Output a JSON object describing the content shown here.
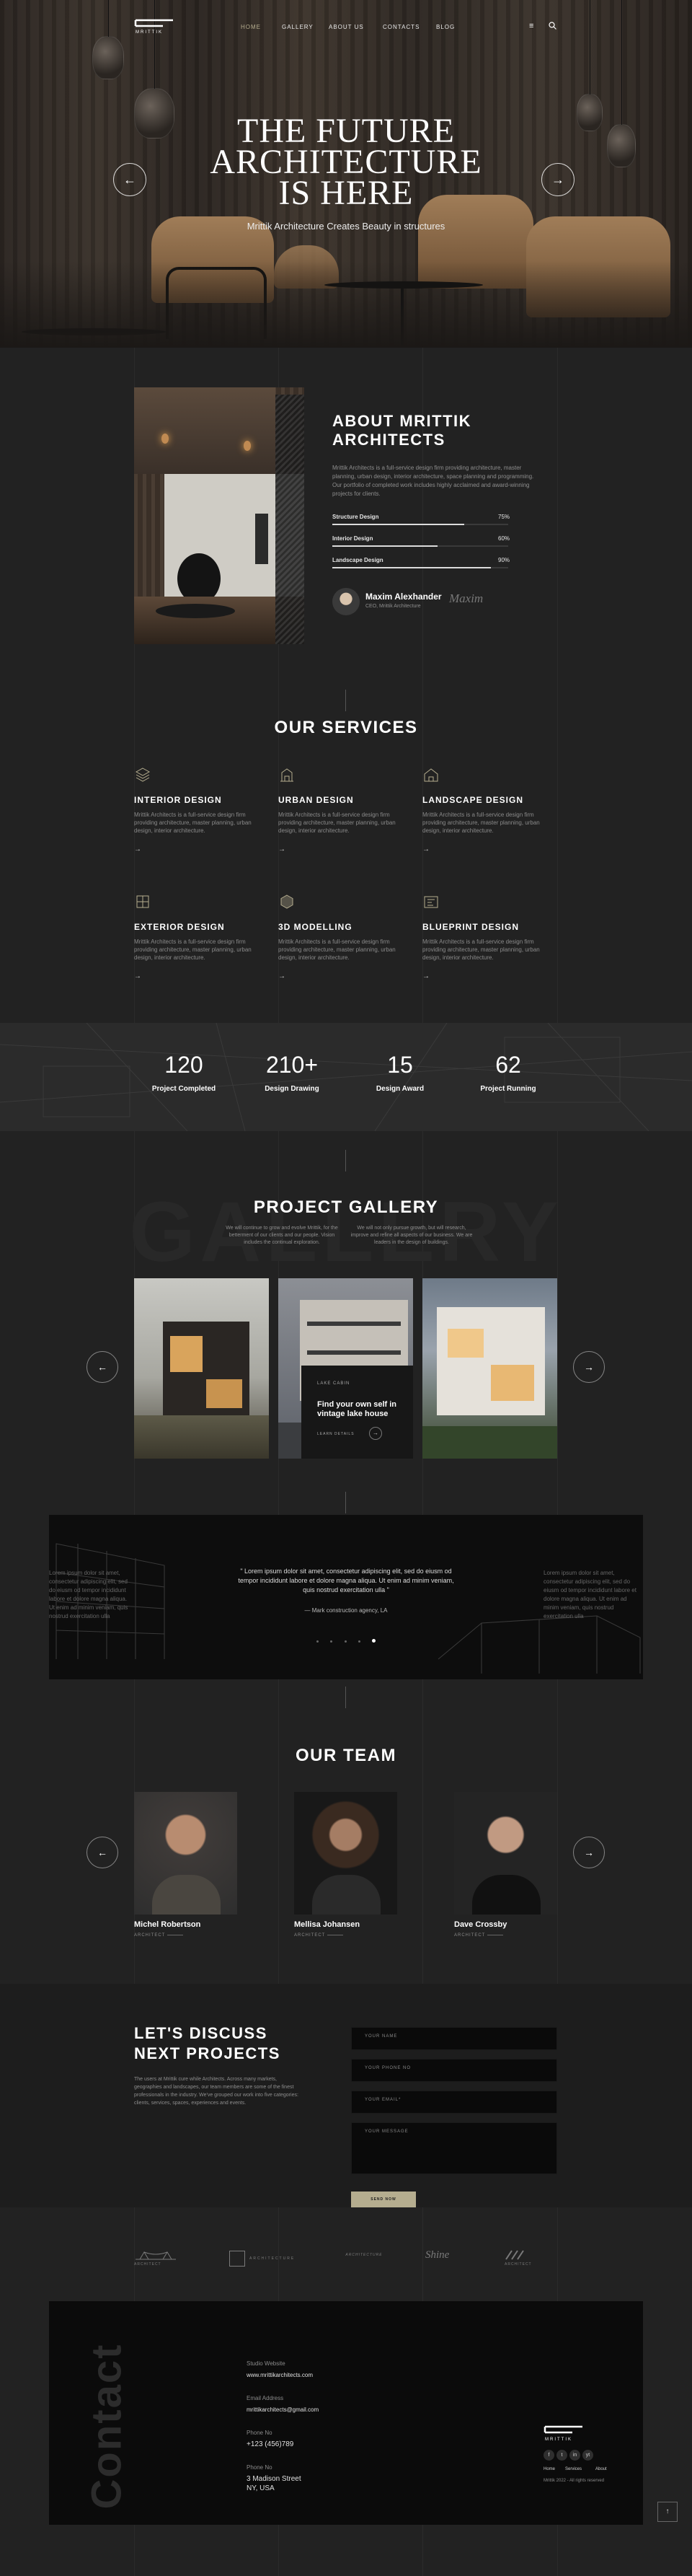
{
  "nav": {
    "items": [
      "HOME",
      "GALLERY",
      "ABOUT US",
      "CONTACTS",
      "BLOG"
    ]
  },
  "hero": {
    "title_lines": [
      "THE FUTURE",
      "ARCHITECTURE",
      "IS HERE"
    ],
    "subtitle": "Mrittik Architecture Creates Beauty in structures"
  },
  "about": {
    "heading_lines": [
      "ABOUT MRITTIK",
      "ARCHITECTS"
    ],
    "text": "Mrittik Architects is a full-service design firm providing architecture, master planning, urban design, interior architecture, space planning and programming. Our portfolio of completed work includes highly acclaimed and award-winning projects for clients.",
    "skills": [
      {
        "label": "Structure Design",
        "value": "75%",
        "fraction": 0.75
      },
      {
        "label": "Interior Design",
        "value": "60%",
        "fraction": 0.6
      },
      {
        "label": "Landscape Design",
        "value": "90%",
        "fraction": 0.9
      }
    ],
    "person_name": "Maxim Alexhander",
    "person_role": "CEO, Mrittik Architecture",
    "signature": "Maxim"
  },
  "services": {
    "heading": "OUR SERVICES",
    "desc": "Mrittik Architects is a full-service design firm providing architecture, master planning, urban design, interior architecture.",
    "items": [
      {
        "title": "INTERIOR DESIGN",
        "icon": "layers-icon"
      },
      {
        "title": "URBAN DESIGN",
        "icon": "city-icon"
      },
      {
        "title": "LANDSCAPE DESIGN",
        "icon": "house-icon"
      },
      {
        "title": "EXTERIOR DESIGN",
        "icon": "exterior-icon"
      },
      {
        "title": "3D MODELLING",
        "icon": "cube-icon"
      },
      {
        "title": "BLUEPRINT DESIGN",
        "icon": "blueprint-icon"
      }
    ]
  },
  "stats": [
    {
      "value": "120",
      "label": "Project Completed"
    },
    {
      "value": "210+",
      "label": "Design Drawing"
    },
    {
      "value": "15",
      "label": "Design Award"
    },
    {
      "value": "62",
      "label": "Project Running"
    }
  ],
  "gallery": {
    "heading": "PROJECT GALLERY",
    "watermark": "GALLERY",
    "intro_left": "We will continue to grow and evolve Mrittik, for the betterment of our clients and our people. Vision includes the continual exploration.",
    "intro_right": "We will not only pursue growth, but will research, improve and refine all aspects of our business. We are leaders in the design of buildings.",
    "card_tag": "LAKE CABIN",
    "card_title_lines": [
      "Find your own self in",
      "vintage lake house"
    ],
    "card_link": "LEARN DETAILS"
  },
  "testimonial": {
    "quote": "\" Lorem ipsum dolor sit amet, consectetur adipiscing elit, sed do eiusm od tempor incididunt labore et dolore magna aliqua. Ut enim ad minim veniam, quis nostrud exercitation ulla \"",
    "author": "Mark construction agency, LA",
    "side_left": "Lorem ipsum dolor sit amet, consectetur adipiscing elit, sed do eiusm od tempor incididunt labore et dolore magna aliqua. Ut enim ad minim veniam, quis nostrud exercitation ulla",
    "side_right": "Lorem ipsum dolor sit amet, consectetur adipiscing elit, sed do eiusm od tempor incididunt labore et dolore magna aliqua. Ut enim ad minim veniam, quis nostrud exercitation ulla"
  },
  "team": {
    "heading": "OUR TEAM",
    "members": [
      {
        "name": "Michel Robertson",
        "role": "ARCHITECT"
      },
      {
        "name": "Mellisa Johansen",
        "role": "ARCHITECT"
      },
      {
        "name": "Dave Crossby",
        "role": "ARCHITECT"
      }
    ]
  },
  "discuss": {
    "heading_lines": [
      "LET'S DISCUSS",
      "NEXT PROJECTS"
    ],
    "text": "The users at Mrittik cure while Architects. Across many markets, geographies and landscapes, our team members are some of the finest professionals in the industry. We've grouped our work into five categories: clients, services, spaces, experiences and events.",
    "fields": {
      "name": "YOUR NAME",
      "phone": "YOUR PHONE NO",
      "email": "YOUR EMAIL*",
      "message": "YOUR MESSAGE"
    },
    "submit": "SEND NOW"
  },
  "brands": [
    "ARCHITECT",
    "ARCHITECTURE",
    "ARCHITECTURE",
    "Shine",
    "ARCHITECT"
  ],
  "footer": {
    "side_title": "Contact",
    "studio_label": "Studio Website",
    "studio_value": "www.mrittikarchitects.com",
    "email_label": "Email Address",
    "email_value": "mrittikarchitects@gmail.com",
    "phone_label": "Phone No",
    "phone_value": "+123 (456)789",
    "office_label": "Phone No",
    "office_lines": [
      "3 Madison Street",
      "NY, USA"
    ],
    "logo_text": "MRITTIK",
    "social": [
      "f",
      "t",
      "in",
      "yt"
    ],
    "links": [
      "Home",
      "Services",
      "About"
    ],
    "copyright": "Mrittik 2022 - All rights reserved"
  },
  "colors": {
    "background": "#222222",
    "accent": "#b5ad8f",
    "footer_bg": "#0b0b0b"
  }
}
